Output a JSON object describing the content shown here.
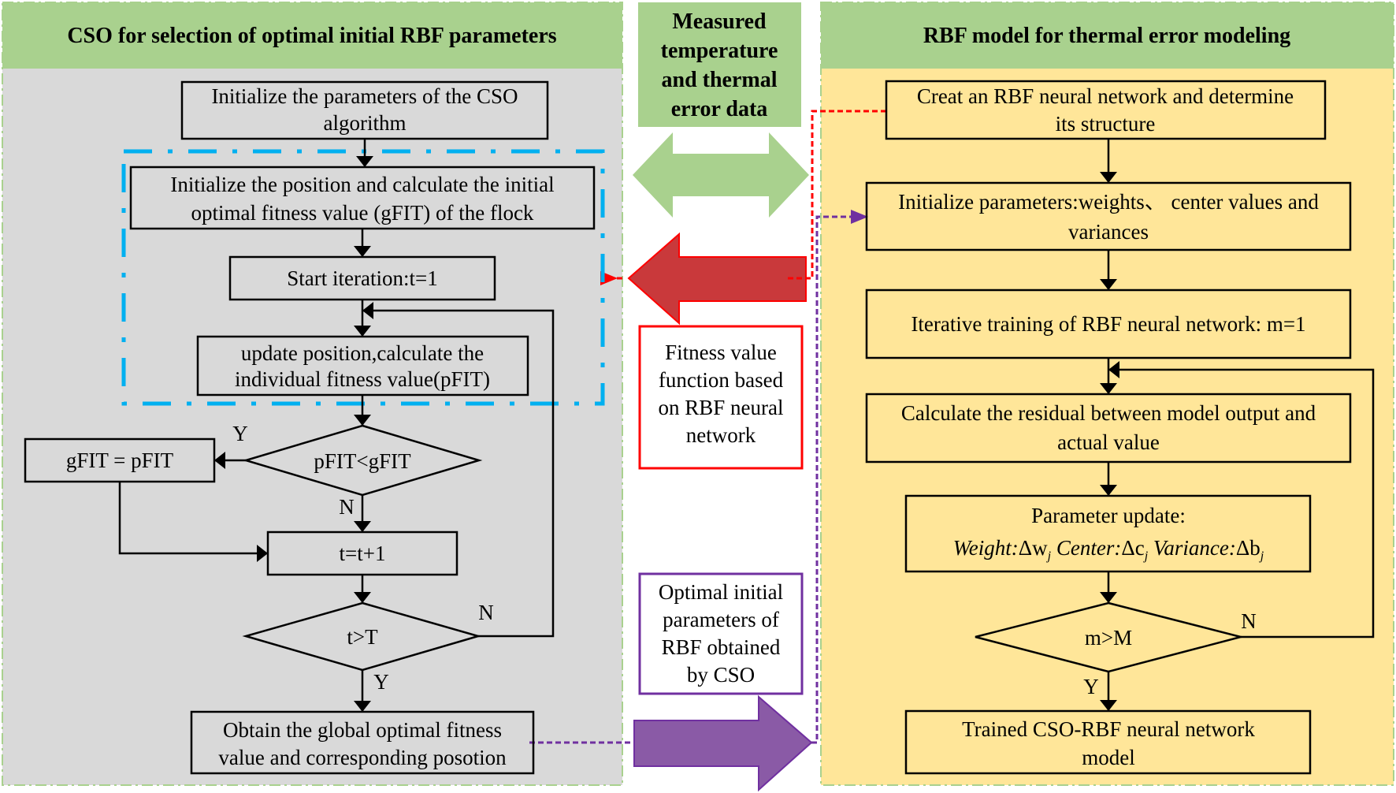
{
  "colors": {
    "header_green": "#a9d18e",
    "left_panel_bg": "#d9d9d9",
    "right_panel_bg": "#ffe699",
    "panel_border_green": "#a9d18e",
    "blue_dashdot": "#00b0f0",
    "red_arrow": "#c9393b",
    "red_border": "#ff0000",
    "purple_arrow": "#8a5aa6",
    "purple_border": "#7030a0",
    "green_arrow": "#a9d18e"
  },
  "left_panel": {
    "title": "CSO for selection of optimal initial RBF parameters",
    "steps": {
      "init_params": [
        "Initialize the parameters of the CSO",
        "algorithm"
      ],
      "init_position": [
        "Initialize the position and calculate the initial",
        "optimal fitness value (gFIT) of the flock"
      ],
      "start_iteration": "Start iteration:t=1",
      "update_position": [
        "update position,calculate the",
        "individual fitness value(pFIT)"
      ],
      "decision_pfit": "pFIT<gFIT",
      "assign_gfit": "gFIT = pFIT",
      "increment_t": "t=t+1",
      "decision_t": "t>T",
      "obtain_global": [
        "Obtain the global optimal fitness",
        "value and corresponding posotion"
      ]
    },
    "labels": {
      "pfit_yes": "Y",
      "pfit_no": "N",
      "t_no": "N",
      "t_yes": "Y"
    }
  },
  "middle": {
    "data_box": [
      "Measured",
      "temperature",
      "and thermal",
      "error data"
    ],
    "fitness_box": [
      "Fitness value",
      "function based",
      "on RBF neural",
      "network"
    ],
    "optimal_box": [
      "Optimal initial",
      "parameters of",
      "RBF obtained",
      "by CSO"
    ]
  },
  "right_panel": {
    "title": "RBF model for thermal error modeling",
    "steps": {
      "create_network": [
        "Creat an RBF neural network and determine",
        "its structure"
      ],
      "init_params": [
        "Initialize parameters:weights、 center values and",
        "variances"
      ],
      "iterative_training": "Iterative training of RBF neural network: m=1",
      "residual": [
        "Calculate the residual between model output and",
        "actual value"
      ],
      "param_update_title": "Parameter update:",
      "param_update_formula": {
        "weight": "Weight",
        "weight_delta": "Δw",
        "center": "Center",
        "center_delta": "Δc",
        "variance": "Variance",
        "variance_delta": "Δb",
        "subscript": "j"
      },
      "decision_m": "m>M",
      "trained_model": [
        "Trained CSO-RBF neural network",
        "model"
      ]
    },
    "labels": {
      "m_no": "N",
      "m_yes": "Y"
    }
  }
}
